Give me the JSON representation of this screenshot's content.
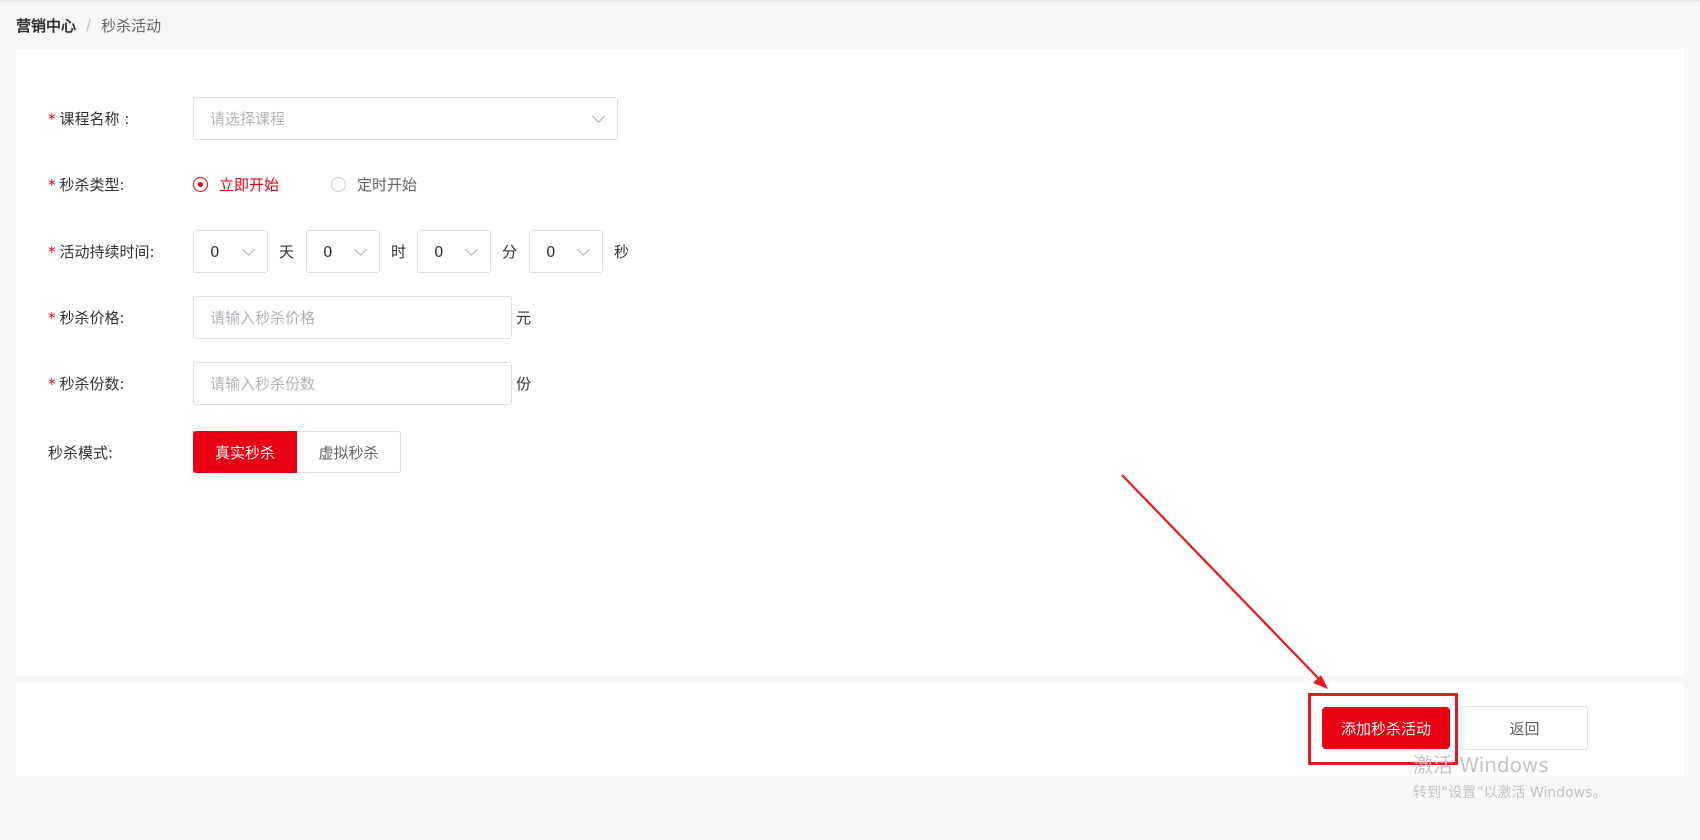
{
  "breadcrumb": {
    "home": "营销中心",
    "separator": "/",
    "current": "秒杀活动"
  },
  "form": {
    "course": {
      "required": "*",
      "label": "课程名称 :",
      "placeholder": "请选择课程"
    },
    "type": {
      "required": "*",
      "label": "秒杀类型:",
      "options": [
        {
          "label": "立即开始",
          "checked": true
        },
        {
          "label": "定时开始",
          "checked": false
        }
      ]
    },
    "duration": {
      "required": "*",
      "label": "活动持续时间:",
      "fields": [
        {
          "value": "0",
          "unit": "天"
        },
        {
          "value": "0",
          "unit": "时"
        },
        {
          "value": "0",
          "unit": "分"
        },
        {
          "value": "0",
          "unit": "秒"
        }
      ]
    },
    "price": {
      "required": "*",
      "label": "秒杀价格:",
      "placeholder": "请输入秒杀价格",
      "unit": "元"
    },
    "quantity": {
      "required": "*",
      "label": "秒杀份数:",
      "placeholder": "请输入秒杀份数",
      "unit": "份"
    },
    "mode": {
      "label": "秒杀模式:",
      "options": [
        {
          "label": "真实秒杀",
          "active": true
        },
        {
          "label": "虚拟秒杀",
          "active": false
        }
      ]
    }
  },
  "actions": {
    "submit": "添加秒杀活动",
    "back": "返回"
  },
  "watermark": {
    "title": "激活 Windows",
    "subtitle": "转到“设置”以激活 Windows。"
  },
  "colors": {
    "accent": "#e60012",
    "annotation": "#e8191e"
  }
}
